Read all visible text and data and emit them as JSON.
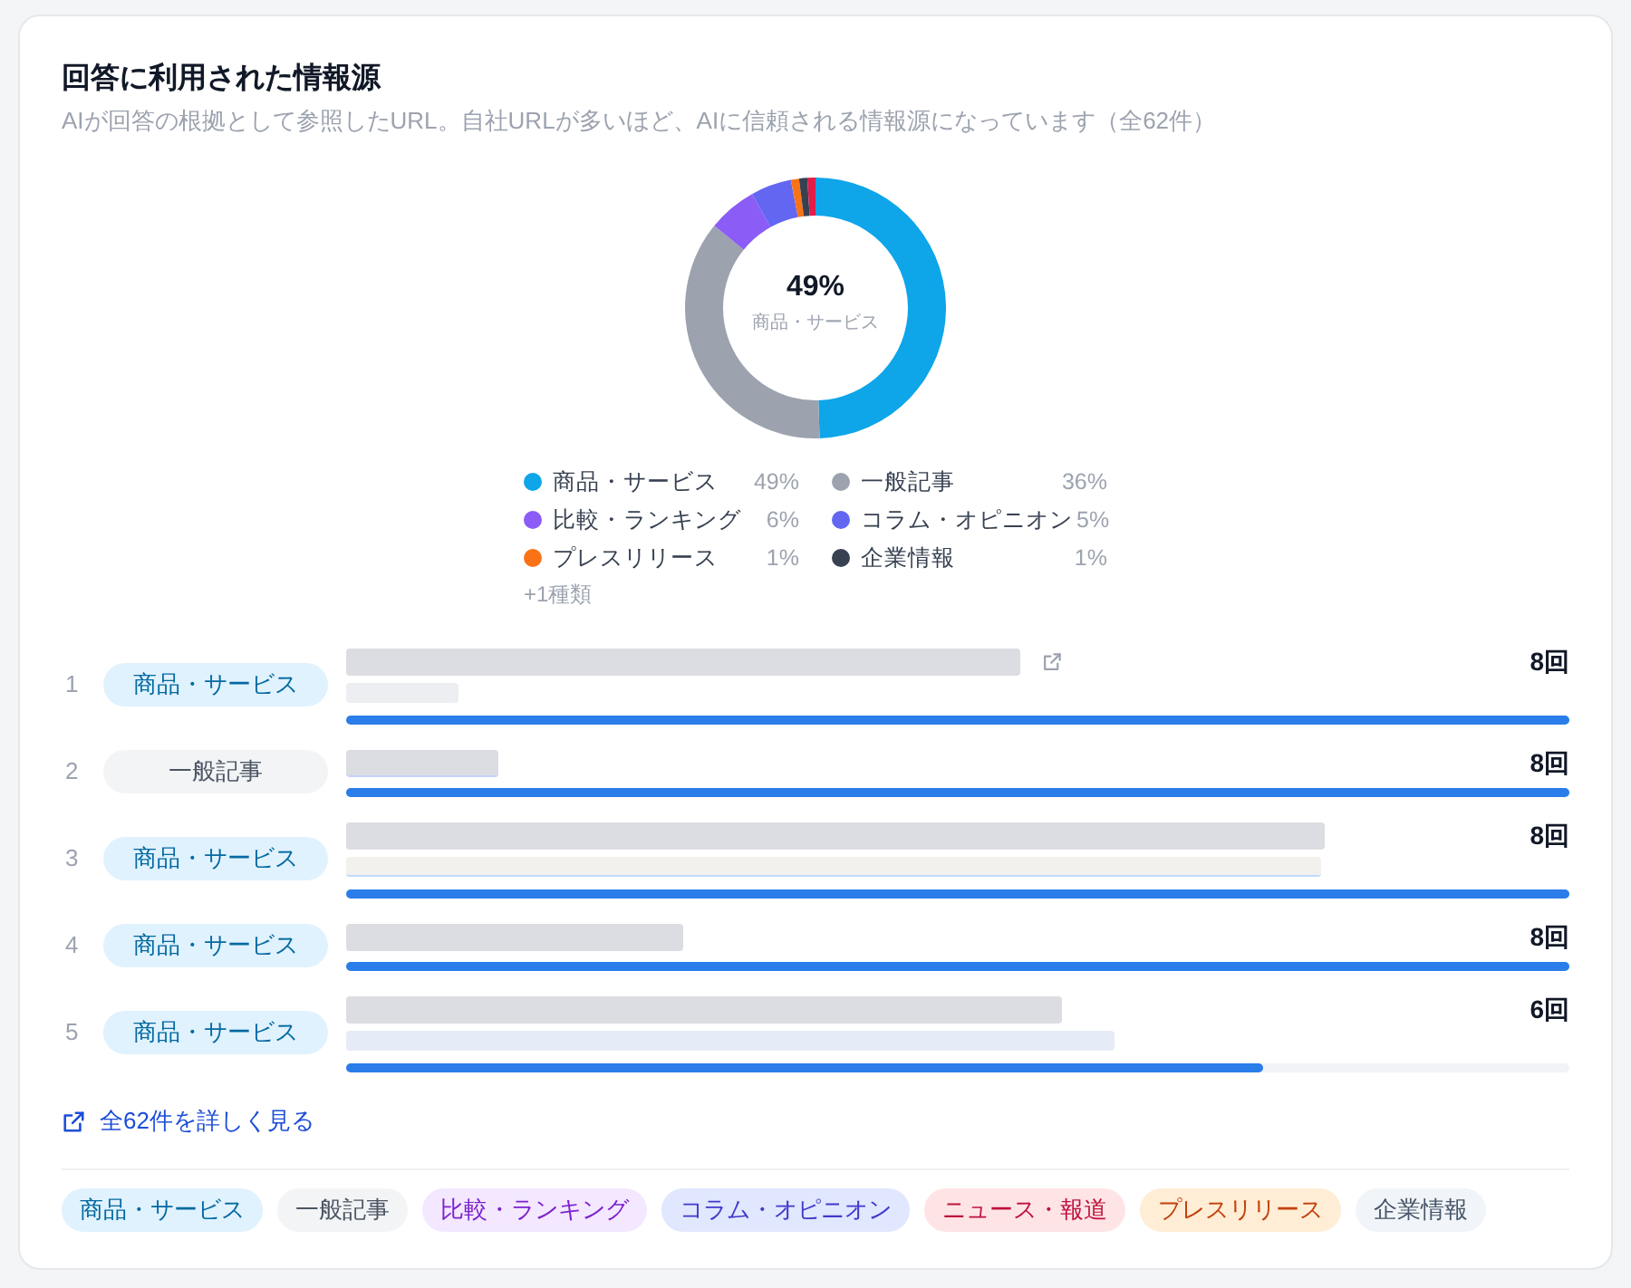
{
  "card": {
    "title": "回答に利用された情報源",
    "subtitle": "AIが回答の根拠として参照したURL。自社URLが多いほど、AIに信頼される情報源になっています（全62件）"
  },
  "donut": {
    "center_value": "49%",
    "center_label": "商品・サービス",
    "chart_data": {
      "type": "donut",
      "values": [
        49,
        36,
        6,
        5,
        1,
        1,
        1
      ],
      "colors": [
        "#0ea5e9",
        "#9ca3af",
        "#8b5cf6",
        "#6366f1",
        "#f97316",
        "#374151",
        "#e11d48"
      ]
    }
  },
  "legend": [
    {
      "label": "商品・サービス",
      "value": "49%",
      "color": "#0ea5e9"
    },
    {
      "label": "一般記事",
      "value": "36%",
      "color": "#9ca3af"
    },
    {
      "label": "比較・ランキング",
      "value": "6%",
      "color": "#8b5cf6"
    },
    {
      "label": "コラム・オピニオン",
      "value": "5%",
      "color": "#6366f1"
    },
    {
      "label": "プレスリリース",
      "value": "1%",
      "color": "#f97316"
    },
    {
      "label": "企業情報",
      "value": "1%",
      "color": "#374151"
    }
  ],
  "legend_more": "+1種類",
  "sources": [
    {
      "rank": "1",
      "kind": "product",
      "category": "商品・サービス",
      "count": "8回",
      "level": 1,
      "link_icon": true
    },
    {
      "rank": "2",
      "kind": "general",
      "category": "一般記事",
      "count": "8回",
      "level": 1,
      "link_icon": false
    },
    {
      "rank": "3",
      "kind": "product",
      "category": "商品・サービス",
      "count": "8回",
      "level": 1,
      "link_icon": false
    },
    {
      "rank": "4",
      "kind": "product",
      "category": "商品・サービス",
      "count": "8回",
      "level": 1,
      "link_icon": false
    },
    {
      "rank": "5",
      "kind": "product",
      "category": "商品・サービス",
      "count": "6回",
      "level": 0.75,
      "link_icon": false
    }
  ],
  "details_link": "全62件を詳しく見る",
  "category_tags": [
    {
      "label": "商品・サービス",
      "kind": "product"
    },
    {
      "label": "一般記事",
      "kind": "general"
    },
    {
      "label": "比較・ランキング",
      "kind": "comparison"
    },
    {
      "label": "コラム・オピニオン",
      "kind": "column"
    },
    {
      "label": "ニュース・報道",
      "kind": "news"
    },
    {
      "label": "プレスリリース",
      "kind": "press"
    },
    {
      "label": "企業情報",
      "kind": "company"
    }
  ]
}
